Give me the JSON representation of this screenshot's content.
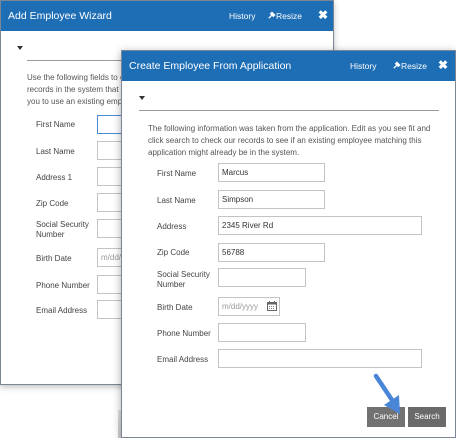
{
  "back_dialog": {
    "title": "Add Employee Wizard",
    "history_label": "History",
    "resize_label": "Resize",
    "close_label": "✖",
    "intro_lines": [
      "Use the following fields to en",
      "records in the system that ar",
      "you to use an existing emplo"
    ],
    "fields": [
      {
        "label": "First Name",
        "value": ""
      },
      {
        "label": "Last Name",
        "value": ""
      },
      {
        "label": "Address 1",
        "value": ""
      },
      {
        "label": "Zip Code",
        "value": ""
      },
      {
        "label": "Social Security Number",
        "value": ""
      },
      {
        "label": "Birth Date",
        "placeholder": "m/dd/y"
      },
      {
        "label": "Phone Number",
        "value": ""
      },
      {
        "label": "Email Address",
        "value": ""
      }
    ]
  },
  "front_dialog": {
    "title": "Create Employee From Application",
    "history_label": "History",
    "resize_label": "Resize",
    "close_label": "✖",
    "intro_lines": [
      "The following information was taken from the application. Edit as you see fit and",
      "click search to check our records to see if an existing employee matching this",
      "application might already be in the system."
    ],
    "fields": {
      "first_name": {
        "label": "First Name",
        "value": "Marcus"
      },
      "last_name": {
        "label": "Last Name",
        "value": "Simpson"
      },
      "address": {
        "label": "Address",
        "value": "2345 River Rd"
      },
      "zip": {
        "label": "Zip Code",
        "value": "56788"
      },
      "ssn": {
        "label": "Social Security Number",
        "value": ""
      },
      "birth_date": {
        "label": "Birth Date",
        "placeholder": "m/dd/yyyy"
      },
      "phone": {
        "label": "Phone Number",
        "value": ""
      },
      "email": {
        "label": "Email Address",
        "value": ""
      }
    },
    "cancel_label": "Cancel",
    "search_label": "Search"
  },
  "colors": {
    "titlebar": "#1e6eb6",
    "button": "#727272",
    "arrow": "#4a86d8"
  },
  "icons": [
    "pin-icon",
    "close-icon",
    "caret-down-icon",
    "calendar-icon",
    "arrow-pointer-icon"
  ]
}
